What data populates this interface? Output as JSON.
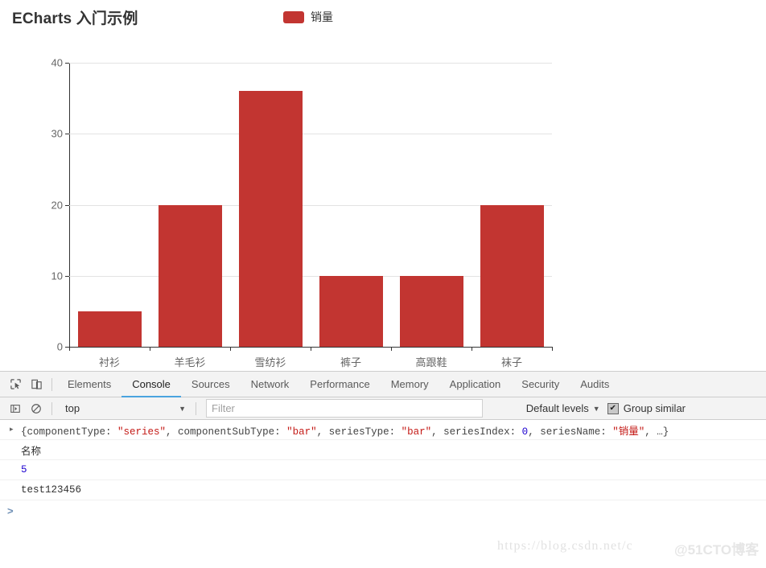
{
  "chart": {
    "title": "ECharts 入门示例",
    "legend": {
      "label": "销量",
      "color": "#c23531"
    }
  },
  "chart_data": {
    "type": "bar",
    "title": "ECharts 入门示例",
    "categories": [
      "衬衫",
      "羊毛衫",
      "雪纺衫",
      "裤子",
      "高跟鞋",
      "袜子"
    ],
    "series": [
      {
        "name": "销量",
        "values": [
          5,
          20,
          36,
          10,
          10,
          20
        ],
        "color": "#c23531"
      }
    ],
    "xlabel": "",
    "ylabel": "",
    "ylim": [
      0,
      40
    ],
    "yticks": [
      0,
      10,
      20,
      30,
      40
    ],
    "grid": true,
    "legend_position": "top-center"
  },
  "devtools": {
    "tabs": [
      {
        "label": "Elements",
        "active": false
      },
      {
        "label": "Console",
        "active": true
      },
      {
        "label": "Sources",
        "active": false
      },
      {
        "label": "Network",
        "active": false
      },
      {
        "label": "Performance",
        "active": false
      },
      {
        "label": "Memory",
        "active": false
      },
      {
        "label": "Application",
        "active": false
      },
      {
        "label": "Security",
        "active": false
      },
      {
        "label": "Audits",
        "active": false
      }
    ],
    "toolbar": {
      "context": "top",
      "filter_placeholder": "Filter",
      "filter_value": "",
      "levels": "Default levels",
      "group_similar": "Group similar",
      "group_similar_checked": "✔"
    },
    "console": {
      "rows": [
        {
          "expandable": "▸",
          "parts": [
            {
              "t": "{componentType: ",
              "k": "key"
            },
            {
              "t": "\"series\"",
              "k": "str"
            },
            {
              "t": ", componentSubType: ",
              "k": "key"
            },
            {
              "t": "\"bar\"",
              "k": "str"
            },
            {
              "t": ", seriesType: ",
              "k": "key"
            },
            {
              "t": "\"bar\"",
              "k": "str"
            },
            {
              "t": ", seriesIndex: ",
              "k": "key"
            },
            {
              "t": "0",
              "k": "num"
            },
            {
              "t": ", seriesName: ",
              "k": "key"
            },
            {
              "t": "\"销量\"",
              "k": "str"
            },
            {
              "t": ", …}",
              "k": "punct"
            }
          ]
        }
      ],
      "line_text": "名称",
      "line_num": "5",
      "line_str": "test123456",
      "prompt": ">"
    }
  },
  "watermark": {
    "url": "https://blog.csdn.net/c",
    "brand": "@51CTO博客"
  }
}
